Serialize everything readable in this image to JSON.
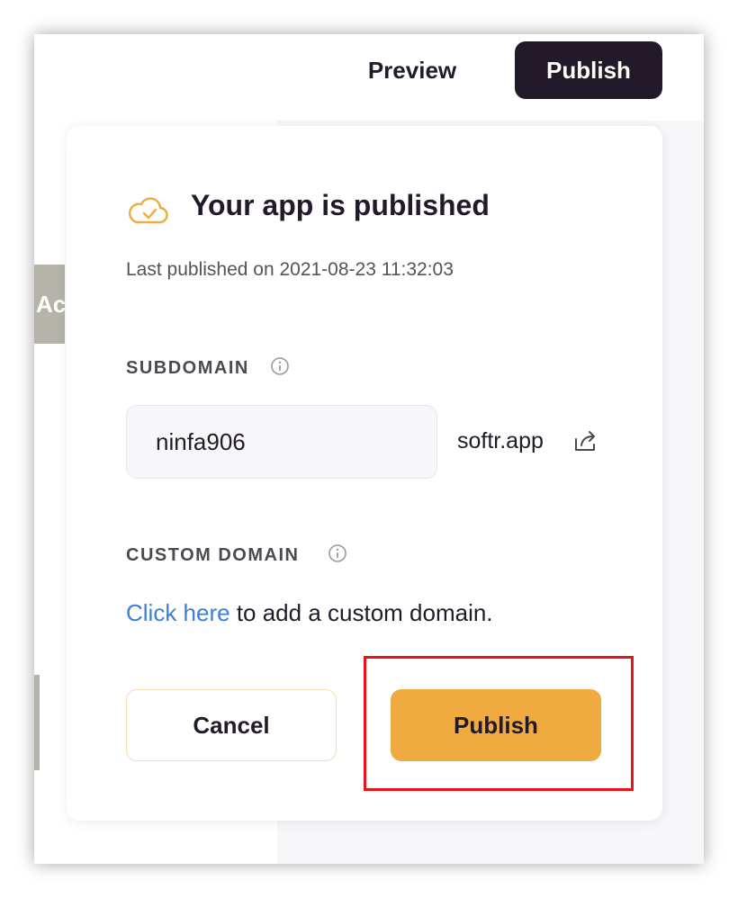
{
  "topbar": {
    "preview_label": "Preview",
    "publish_label": "Publish"
  },
  "background": {
    "tab_text": "Ac"
  },
  "modal": {
    "icon": "cloud-check-icon",
    "title": "Your app is published",
    "last_published": "Last published on 2021-08-23 11:32:03",
    "subdomain": {
      "label": "SUBDOMAIN",
      "info_icon": "info-icon",
      "value": "ninfa906",
      "suffix": "softr.app",
      "open_icon": "share-external-icon"
    },
    "custom_domain": {
      "label": "CUSTOM DOMAIN",
      "info_icon": "info-icon",
      "link_text": "Click here",
      "rest_text": " to add a custom domain."
    },
    "cancel_label": "Cancel",
    "publish_label": "Publish"
  },
  "colors": {
    "dark": "#231a29",
    "accent": "#efaa40",
    "link": "#3c7fd6",
    "highlight": "#e8141a"
  }
}
